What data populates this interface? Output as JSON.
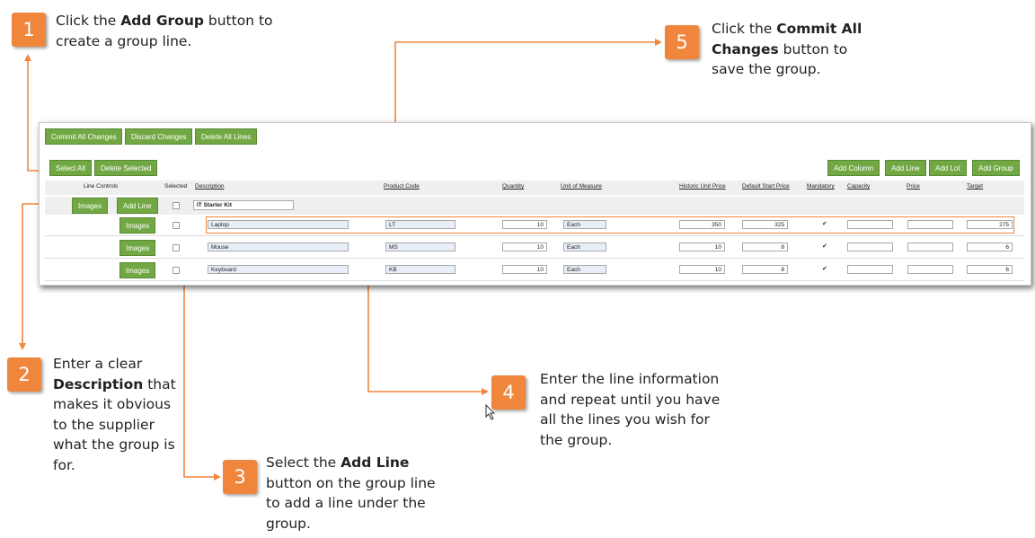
{
  "callouts": {
    "c1": {
      "num": "1",
      "pre": "Click the ",
      "bold": "Add Group",
      "post": " button to create a group line."
    },
    "c2": {
      "num": "2",
      "pre": "Enter a clear ",
      "bold": "Description",
      "post": " that makes it obvious to the supplier what the group is for."
    },
    "c3": {
      "num": "3",
      "pre": "Select the ",
      "bold": "Add Line",
      "post": " button on the group line to add a line under the group."
    },
    "c4": {
      "num": "4",
      "text": "Enter the line information and repeat until you have all the lines you wish for the group."
    },
    "c5": {
      "num": "5",
      "pre": "Click the ",
      "bold": "Commit All Changes",
      "post": " button to save the group."
    }
  },
  "toolbar": {
    "commit_all_changes": "Commit All Changes",
    "discard_changes": "Discard Changes",
    "delete_all_lines": "Delete All Lines",
    "select_all": "Select All",
    "delete_selected": "Delete Selected",
    "add_column": "Add Column",
    "add_line": "Add Line",
    "add_lot": "Add Lot",
    "add_group": "Add Group"
  },
  "columns": {
    "line_controls": "Line Controls",
    "selected": "Selected",
    "description": "Description",
    "product_code": "Product Code",
    "quantity": "Quantity",
    "unit_of_measure": "Unit of Measure",
    "historic_unit_price": "Historic Unit Price",
    "default_start_price": "Default Start Price",
    "mandatory": "Mandatory",
    "capacity": "Capacity",
    "price": "Price",
    "target": "Target"
  },
  "group_row": {
    "images": "Images",
    "add_line": "Add Line",
    "description": "IT Starter Kit"
  },
  "rows": [
    {
      "images": "Images",
      "description": "Laptop",
      "product_code": "LT",
      "quantity": "10",
      "uom": "Each",
      "historic": "350",
      "default_start": "325",
      "mandatory": "✔",
      "capacity": "",
      "price": "",
      "target": "275"
    },
    {
      "images": "Images",
      "description": "Mouse",
      "product_code": "MS",
      "quantity": "10",
      "uom": "Each",
      "historic": "10",
      "default_start": "8",
      "mandatory": "✔",
      "capacity": "",
      "price": "",
      "target": "6"
    },
    {
      "images": "Images",
      "description": "Keyboard",
      "product_code": "KB",
      "quantity": "10",
      "uom": "Each",
      "historic": "10",
      "default_start": "8",
      "mandatory": "✔",
      "capacity": "",
      "price": "",
      "target": "6"
    }
  ],
  "colors": {
    "accent": "#f0863c",
    "button_green": "#72a844"
  }
}
